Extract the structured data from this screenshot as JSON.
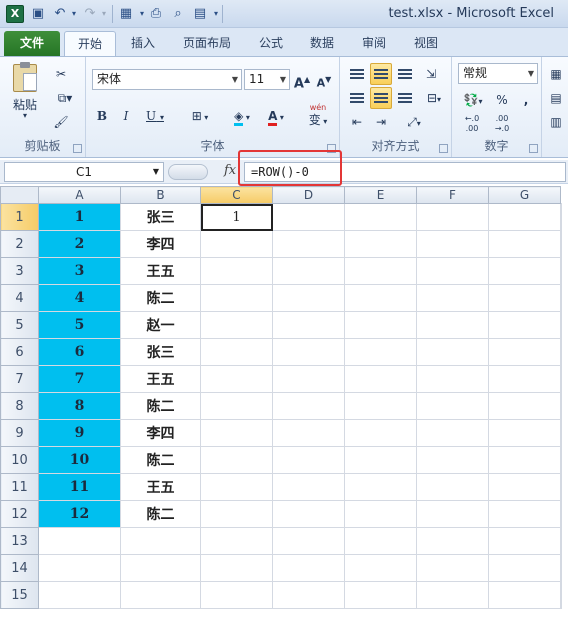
{
  "window": {
    "title": "test.xlsx - Microsoft Excel",
    "app_logo": "X"
  },
  "tabs": [
    "文件",
    "开始",
    "插入",
    "页面布局",
    "公式",
    "数据",
    "审阅",
    "视图"
  ],
  "ribbon": {
    "clipboard": {
      "label": "剪贴板",
      "paste": "粘贴"
    },
    "font": {
      "label": "字体",
      "name": "宋体",
      "size": "11",
      "bold": "B",
      "italic": "I",
      "underline": "U",
      "increase": "A",
      "decrease": "A",
      "phonetic": "wén",
      "phonetic_char": "变",
      "font_color_letter": "A"
    },
    "alignment": {
      "label": "对齐方式"
    },
    "number": {
      "label": "数字",
      "format": "常规",
      "percent": "%",
      "comma": ",",
      "inc_decimal": "←.0 .00",
      "dec_decimal": ".00 →.0"
    }
  },
  "formula_bar": {
    "name_box": "C1",
    "fx": "fx",
    "formula": "=ROW()-0"
  },
  "grid": {
    "columns": [
      "A",
      "B",
      "C",
      "D",
      "E",
      "F",
      "G"
    ],
    "active_column": "C",
    "active_row": 1,
    "rows": [
      {
        "n": "1",
        "a": "1",
        "b": "张三",
        "c": "1"
      },
      {
        "n": "2",
        "a": "2",
        "b": "李四",
        "c": ""
      },
      {
        "n": "3",
        "a": "3",
        "b": "王五",
        "c": ""
      },
      {
        "n": "4",
        "a": "4",
        "b": "陈二",
        "c": ""
      },
      {
        "n": "5",
        "a": "5",
        "b": "赵一",
        "c": ""
      },
      {
        "n": "6",
        "a": "6",
        "b": "张三",
        "c": ""
      },
      {
        "n": "7",
        "a": "7",
        "b": "王五",
        "c": ""
      },
      {
        "n": "8",
        "a": "8",
        "b": "陈二",
        "c": ""
      },
      {
        "n": "9",
        "a": "9",
        "b": "李四",
        "c": ""
      },
      {
        "n": "10",
        "a": "10",
        "b": "陈二",
        "c": ""
      },
      {
        "n": "11",
        "a": "11",
        "b": "王五",
        "c": ""
      },
      {
        "n": "12",
        "a": "12",
        "b": "陈二",
        "c": ""
      },
      {
        "n": "13",
        "a": "",
        "b": "",
        "c": ""
      },
      {
        "n": "14",
        "a": "",
        "b": "",
        "c": ""
      },
      {
        "n": "15",
        "a": "",
        "b": "",
        "c": ""
      }
    ]
  },
  "colors": {
    "column_a_fill": "#00BFEF",
    "highlight_box": "#E33636",
    "file_tab": "#2F7F2F"
  }
}
